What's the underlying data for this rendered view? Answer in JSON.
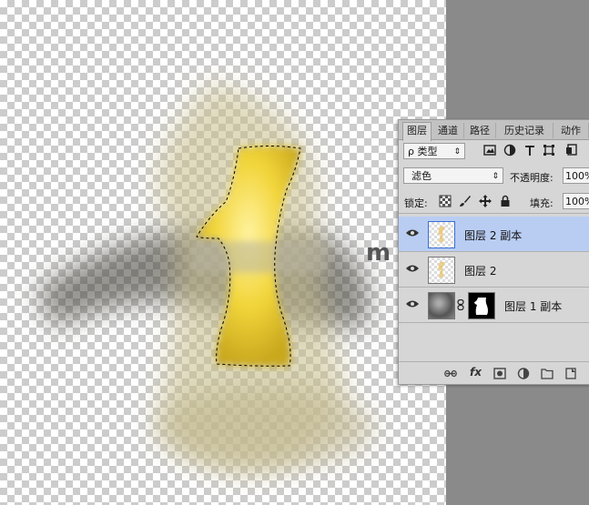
{
  "panel": {
    "tabs": [
      {
        "label": "图层",
        "active": true
      },
      {
        "label": "通道",
        "active": false
      },
      {
        "label": "路径",
        "active": false
      },
      {
        "label": "历史记录",
        "active": false
      },
      {
        "label": "动作",
        "active": false
      }
    ],
    "filter": {
      "label": "ρ 类型",
      "chevron": "⇕"
    },
    "blend_mode": {
      "value": "滤色",
      "chevron": "⇕"
    },
    "opacity": {
      "label": "不透明度:",
      "value": "100%"
    },
    "lock": {
      "label": "锁定:"
    },
    "fill": {
      "label": "填充:",
      "value": "100%"
    },
    "layers": [
      {
        "name": "图层 2 副本",
        "selected": true,
        "visible": true,
        "has_mask": false
      },
      {
        "name": "图层 2",
        "selected": false,
        "visible": true,
        "has_mask": false
      },
      {
        "name": "图层 1 副本",
        "selected": false,
        "visible": true,
        "has_mask": true
      }
    ],
    "colors": {
      "selected_row": "#b9cdf3",
      "panel_bg": "#d6d6d6"
    }
  },
  "canvas": {
    "watermark": "m",
    "glow_color": "#f2d53a"
  }
}
